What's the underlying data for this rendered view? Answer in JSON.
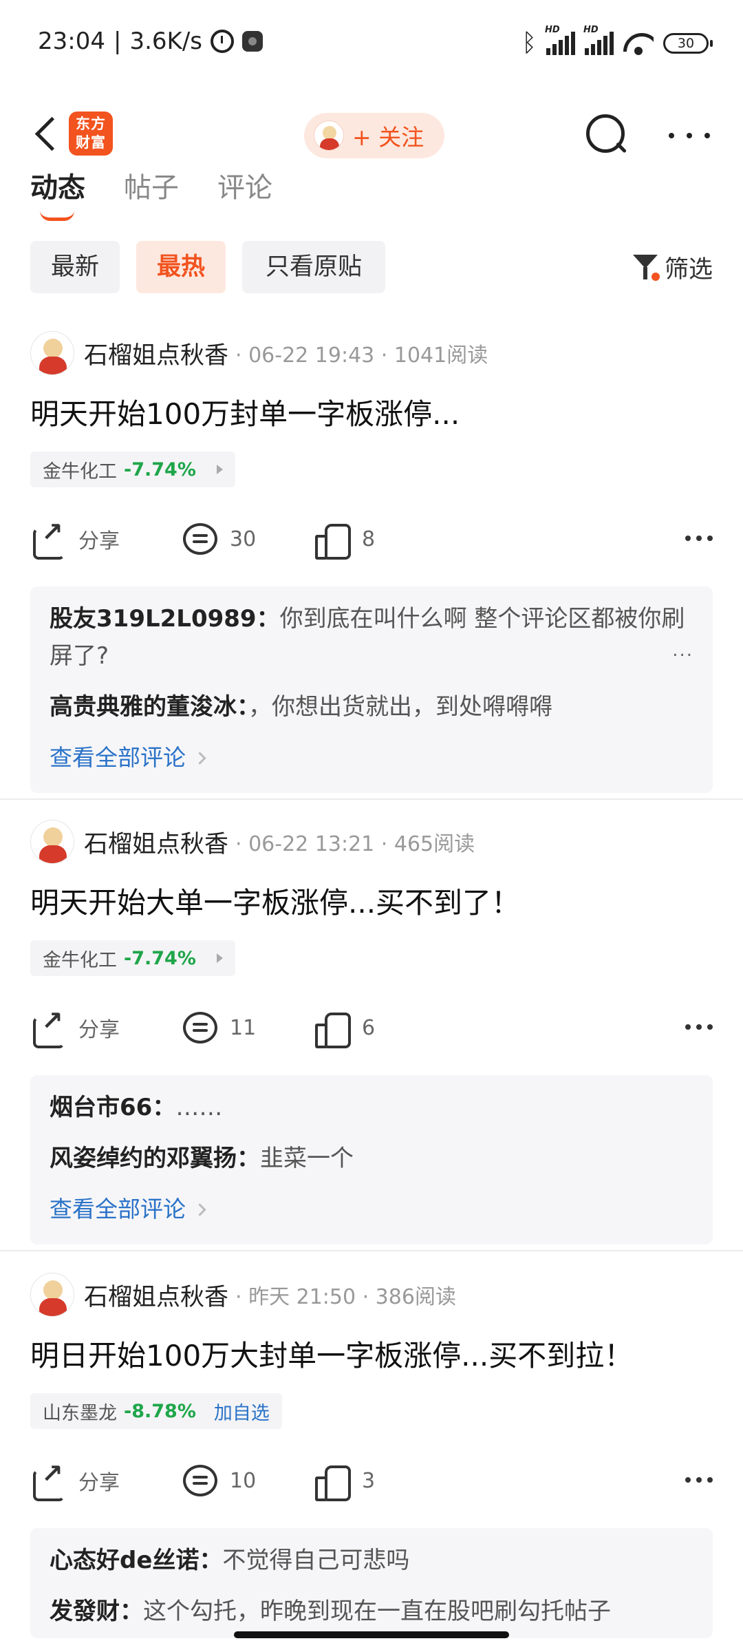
{
  "status_bar": {
    "time": "23:04",
    "speed": "3.6K/s",
    "signal_label": "HD",
    "battery": "30"
  },
  "header": {
    "logo_line1": "东方",
    "logo_line2": "财富",
    "follow_label": "+ 关注",
    "icons": [
      "back-icon",
      "search-icon",
      "more-icon"
    ]
  },
  "tabs": [
    {
      "label": "动态",
      "active": true
    },
    {
      "label": "帖子",
      "active": false
    },
    {
      "label": "评论",
      "active": false
    }
  ],
  "filters": {
    "chips": [
      {
        "label": "最新",
        "active": false
      },
      {
        "label": "最热",
        "active": true
      },
      {
        "label": "只看原贴",
        "active": false
      }
    ],
    "filter_label": "筛选"
  },
  "colors": {
    "accent": "#f2531f",
    "link": "#2a72c8",
    "down": "#1fa64a"
  },
  "posts": [
    {
      "author": "石榴姐点秋香",
      "meta": "· 06-22 19:43 · 1041阅读",
      "title": "明天开始100万封单一字板涨停...",
      "stock_name": "金牛化工",
      "stock_change": "-7.74%",
      "share_label": "分享",
      "comments_count": "30",
      "likes_count": "8",
      "comments": [
        {
          "user": "股友319L2L0989",
          "text": "你到底在叫什么啊 整个评论区都被你刷屏了?"
        },
        {
          "user": "高贵典雅的董浚冰",
          "text": "，你想出货就出，到处嘚嘚嘚"
        }
      ],
      "view_all": "查看全部评论"
    },
    {
      "author": "石榴姐点秋香",
      "meta": "· 06-22 13:21 · 465阅读",
      "title": "明天开始大单一字板涨停...买不到了！",
      "stock_name": "金牛化工",
      "stock_change": "-7.74%",
      "share_label": "分享",
      "comments_count": "11",
      "likes_count": "6",
      "comments": [
        {
          "user": "烟台市66",
          "text": "……"
        },
        {
          "user": "风姿绰约的邓翼扬",
          "text": "韭菜一个"
        }
      ],
      "view_all": "查看全部评论"
    },
    {
      "author": "石榴姐点秋香",
      "meta": "· 昨天 21:50 · 386阅读",
      "title": "明日开始100万大封单一字板涨停...买不到拉！",
      "stock_name": "山东墨龙",
      "stock_change": "-8.78%",
      "add_watch": "加自选",
      "share_label": "分享",
      "comments_count": "10",
      "likes_count": "3",
      "comments": [
        {
          "user": "心态好de丝诺",
          "text": "不觉得自己可悲吗"
        },
        {
          "user": "发發财",
          "text": "这个勾托，昨晚到现在一直在股吧刷勾托帖子"
        }
      ]
    }
  ]
}
